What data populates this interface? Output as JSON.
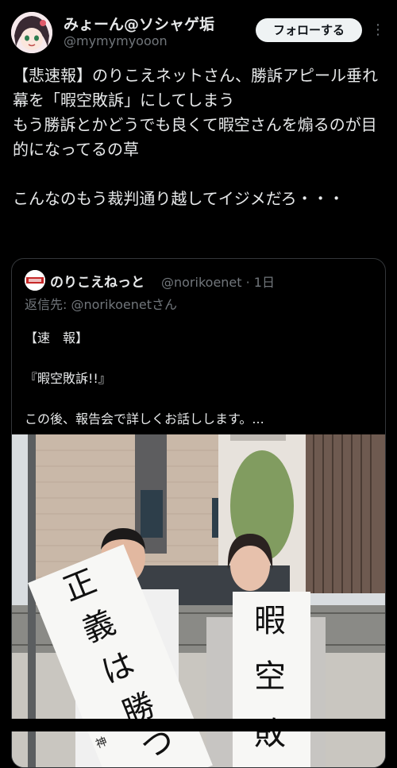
{
  "author": {
    "name": "みょーん@ソシャゲ垢",
    "handle": "@mymymyooon"
  },
  "follow_label": "フォローする",
  "more_label": "⋮",
  "tweet": {
    "text": "【悲速報】のりこえネットさん、勝訴アピール垂れ幕を「暇空敗訴」にしてしまう\nもう勝訴とかどうでも良くて暇空さんを煽るのが目的になってるの草\n\nこんなのもう裁判通り越してイジメだろ・・・"
  },
  "quoted": {
    "name": "のりこえねっと",
    "handle_time": "@norikoenet · 1日",
    "reply_to": "返信先: @norikoenetさん",
    "lines": [
      "【速　報】",
      "『暇空敗訴!!』",
      "この後、報告会で詳しくお話しします。..."
    ]
  },
  "photo": {
    "left_sign": "正義は勝つ",
    "left_sign_small": "神",
    "right_sign": "暇空敗"
  },
  "colors": {
    "background": "#000000",
    "text": "#e7e9ea",
    "muted": "#71767b",
    "border": "#333639",
    "button_bg": "#eff3f4"
  }
}
